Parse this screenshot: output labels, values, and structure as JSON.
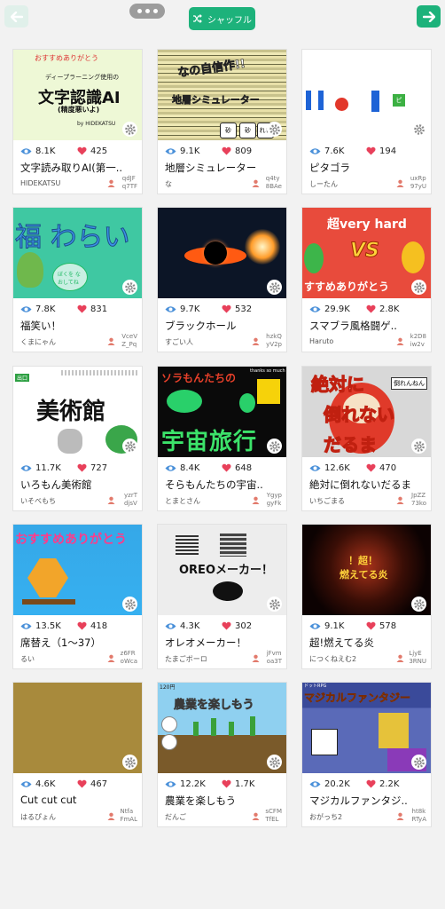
{
  "toolbar": {
    "shuffle_label": "シャッフル"
  },
  "cards": [
    {
      "views": "8.1K",
      "likes": "425",
      "title": "文字読み取りAI(第一..",
      "author": "HIDEKATSU",
      "id1": "qdJF",
      "id2": "q7TF",
      "thumb": {
        "top": "おすすめありがとう",
        "sub": "ディープラーニング使用の",
        "big": "文字認識AI",
        "paren": "(精度悪いよ)",
        "by": "by HIDEKATSU"
      }
    },
    {
      "views": "9.1K",
      "likes": "809",
      "title": "地層シミュレーター",
      "author": "な",
      "id1": "q4ty",
      "id2": "8BAe",
      "thumb": {
        "line1": "なの自信作!!",
        "line2": "地層シミュレーター",
        "b1": "砂",
        "b2": "砂",
        "b3": "れき"
      }
    },
    {
      "views": "7.6K",
      "likes": "194",
      "title": "ピタゴラ",
      "author": "しーたん",
      "id1": "uxRp",
      "id2": "97yU",
      "thumb": {
        "tag": "ピ"
      }
    },
    {
      "views": "7.8K",
      "likes": "831",
      "title": "福笑い！",
      "author": "くまにゃん",
      "id1": "VceV",
      "id2": "Z_Pq",
      "thumb": {
        "big": "福 わらい",
        "note": "ぼくを なおしてね"
      }
    },
    {
      "views": "9.7K",
      "likes": "532",
      "title": "ブラックホール",
      "author": "すごい人",
      "id1": "hzkQ",
      "id2": "yV2p",
      "thumb": {}
    },
    {
      "views": "29.9K",
      "likes": "2.8K",
      "title": "スマブラ風格闘ゲ..",
      "author": "Haruto",
      "id1": "k2D8",
      "id2": "iw2v",
      "thumb": {
        "top": "超very hard",
        "vs": "VS",
        "bottom": "すすめありがとう"
      }
    },
    {
      "views": "11.7K",
      "likes": "727",
      "title": "いろもん美術館",
      "author": "いそべもち",
      "id1": "yzrT",
      "id2": "djsV",
      "thumb": {
        "big": "美術館",
        "sign": "出口"
      }
    },
    {
      "views": "8.4K",
      "likes": "648",
      "title": "そらもんたちの宇宙..",
      "author": "とまとさん",
      "id1": "Ygyp",
      "id2": "gyFk",
      "thumb": {
        "top": "ソラもんたちの",
        "big": "宇宙旅行",
        "thanks": "thanks so much"
      }
    },
    {
      "views": "12.6K",
      "likes": "470",
      "title": "絶対に倒れないだるま",
      "author": "いちごまる",
      "id1": "JpZZ",
      "id2": "73ko",
      "thumb": {
        "l1": "絶対に",
        "l2": "倒れない",
        "l3": "だるま",
        "tag": "倒れんねん"
      }
    },
    {
      "views": "13.5K",
      "likes": "418",
      "title": "席替え（1〜37）",
      "author": "るい",
      "id1": "z6FR",
      "id2": "oWca",
      "thumb": {
        "top": "おすすめありがとう"
      }
    },
    {
      "views": "4.3K",
      "likes": "302",
      "title": "オレオメーカー！",
      "author": "たまごボーロ",
      "id1": "jFvm",
      "id2": "oa3T",
      "thumb": {
        "big": "OREOメーカー！"
      }
    },
    {
      "views": "9.1K",
      "likes": "578",
      "title": "超!燃えてる炎",
      "author": "につくねえむ2",
      "id1": "LjyE",
      "id2": "3RNU",
      "thumb": {
        "l1": "！超！",
        "l2": "燃えてる炎"
      }
    },
    {
      "views": "4.6K",
      "likes": "467",
      "title": "Cut cut cut",
      "author": "はるぴょん",
      "id1": "Ntfa",
      "id2": "FmAL",
      "thumb": {}
    },
    {
      "views": "12.2K",
      "likes": "1.7K",
      "title": "農業を楽しもう",
      "author": "だんご",
      "id1": "sCFM",
      "id2": "TfEL",
      "thumb": {
        "big": "農業を楽しもう",
        "money": "120円"
      }
    },
    {
      "views": "20.2K",
      "likes": "2.2K",
      "title": "マジカルファンタジ..",
      "author": "おがっち2",
      "id1": "ht8k",
      "id2": "RTyA",
      "thumb": {
        "big": "マジカルファンタジー",
        "sub": "ドットRPG"
      }
    }
  ]
}
